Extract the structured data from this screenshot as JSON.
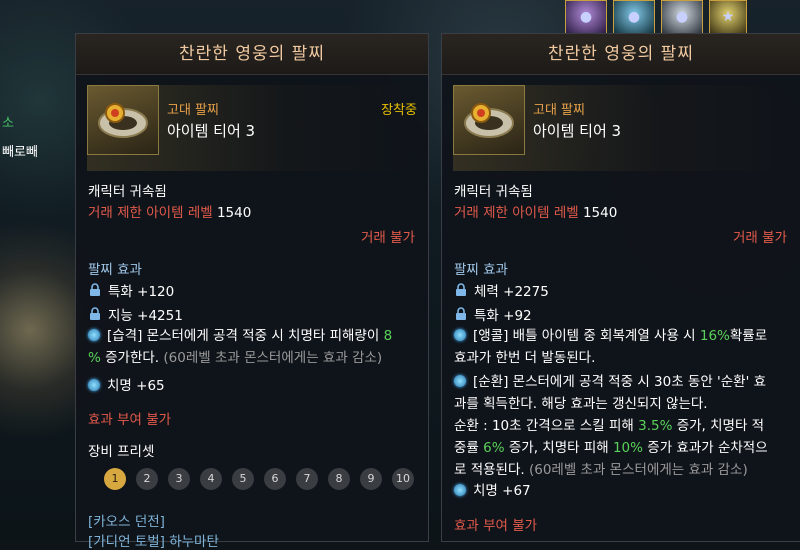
{
  "left_fragments": {
    "green": "소",
    "white": "빼로빼"
  },
  "panels": {
    "left": {
      "title": "찬란한 영웅의 팔찌",
      "grade": "고대 팔찌",
      "tier": "아이템 티어 3",
      "equipped": "장착중",
      "bound": "캐릭터 귀속됨",
      "trade_limit_label": "거래 제한 아이템 레벨",
      "trade_limit_value": "1540",
      "untradeable": "거래 불가",
      "effects_header": "팔찌 효과",
      "stat1": "특화 +120",
      "stat2": "지능 +4251",
      "special1_a": "[습격] 몬스터에게 공격 적중 시 치명타 피해량이 ",
      "special1_pct": "8",
      "special1_b": "%",
      "special1_c": " 증가한다.",
      "special1_note": " (60레벨 초과 몬스터에게는 효과 감소)",
      "stat3": "치명 +65",
      "no_effect": "효과 부여 불가",
      "preset_label": "장비 프리셋",
      "presets": [
        "1",
        "2",
        "3",
        "4",
        "5",
        "6",
        "7",
        "8",
        "9",
        "10"
      ],
      "link1": "[카오스 던전]",
      "link2": "[가디언 토벌] 하누마탄"
    },
    "right": {
      "title": "찬란한 영웅의 팔찌",
      "grade": "고대 팔찌",
      "tier": "아이템 티어 3",
      "bound": "캐릭터 귀속됨",
      "trade_limit_label": "거래 제한 아이템 레벨",
      "trade_limit_value": "1540",
      "untradeable": "거래 불가",
      "effects_header": "팔찌 효과",
      "stat1": "체력 +2275",
      "stat2": "특화 +92",
      "sp1_a": "[앵콜] 배틀 아이템 중 회복계열 사용 시 ",
      "sp1_pct": "16%",
      "sp1_b": "확률로",
      "sp1_line2": "효과가 한번 더 발동된다.",
      "sp2_a": "[순환] 몬스터에게 공격 적중 시 30초 동안 '순환' 효",
      "sp2_line2": "과를 획득한다. 해당 효과는 갱신되지 않는다.",
      "sp2_line3_a": "순환 : 10초 간격으로 스킬 피해 ",
      "sp2_line3_pct": "3.5%",
      "sp2_line3_b": " 증가, 치명타 적",
      "sp2_line4_a": "중률 ",
      "sp2_line4_pct1": "6%",
      "sp2_line4_b": " 증가, 치명타 피해 ",
      "sp2_line4_pct2": "10%",
      "sp2_line4_c": " 증가 효과가 순차적으",
      "sp2_line5_a": "로 적용된다.",
      "sp2_line5_note": " (60레벨 초과 몬스터에게는 효과 감소)",
      "stat3": "치명 +67",
      "no_effect": "효과 부여 불가"
    }
  }
}
